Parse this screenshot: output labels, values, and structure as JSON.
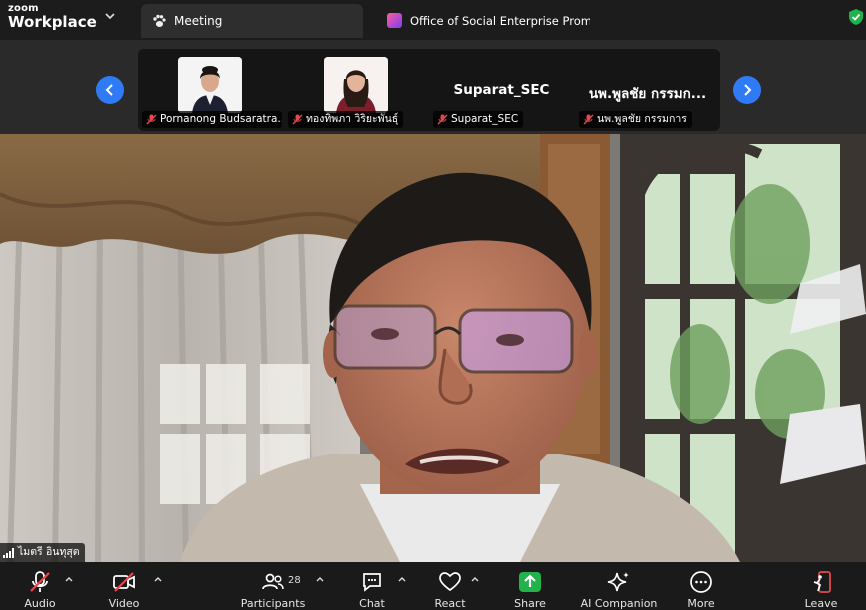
{
  "brand": {
    "line1": "zoom",
    "line2": "Workplace"
  },
  "tabs": {
    "meeting": "Meeting",
    "office": "Office of Social Enterprise Promotion ("
  },
  "gallery": {
    "tiles": [
      {
        "label": "Pornanong Budsaratra..."
      },
      {
        "label": "ทองทิพภา วิริยะพันธุ์"
      },
      {
        "name": "Suparat_SEC",
        "label": "Suparat_SEC"
      },
      {
        "name": "นพ.พูลชัย กรรมก...",
        "label": "นพ.พูลชัย กรรมการ"
      }
    ]
  },
  "speaker": {
    "label": "ไมตรี อินทุสุต"
  },
  "toolbar": {
    "audio": "Audio",
    "video": "Video",
    "participants": "Participants",
    "participants_count": "28",
    "chat": "Chat",
    "react": "React",
    "share": "Share",
    "ai_companion": "AI Companion",
    "more": "More",
    "leave": "Leave"
  },
  "colors": {
    "accent_blue": "#2f7bf5",
    "share_green": "#21b24b",
    "mute_red": "#e5484d",
    "leave_red": "#e5484d"
  }
}
